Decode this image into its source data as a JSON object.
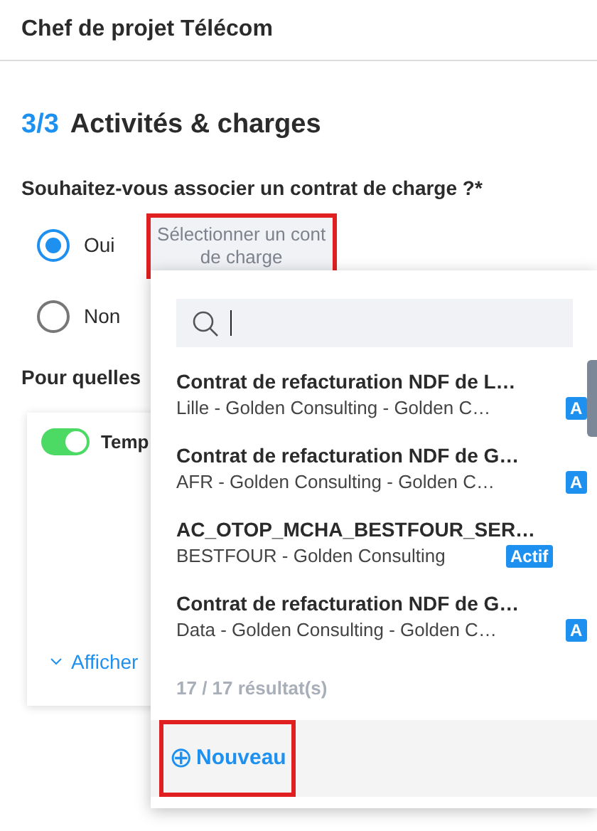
{
  "header": {
    "title": "Chef de projet Télécom"
  },
  "section": {
    "step": "3/3",
    "title": "Activités & charges"
  },
  "question": {
    "label": "Souhaitez-vous associer un contrat de charge ?*",
    "options": [
      {
        "label": "Oui",
        "selected": true
      },
      {
        "label": "Non",
        "selected": false
      }
    ],
    "select_button": {
      "label": "Sélectionner un cont de charge",
      "highlighted": true
    }
  },
  "sub_question": {
    "label": "Pour quelles"
  },
  "card": {
    "toggle": {
      "on": true,
      "label": "Temp"
    },
    "show_more": "Afficher"
  },
  "dropdown": {
    "items": [
      {
        "title": "Contrat de refacturation NDF de L…",
        "subtitle": "Lille - Golden Consulting - Golden C…",
        "badge": "A"
      },
      {
        "title": "Contrat de refacturation NDF de G…",
        "subtitle": "AFR - Golden Consulting - Golden C…",
        "badge": "A"
      },
      {
        "title": "AC_OTOP_MCHA_BESTFOUR_SER…",
        "subtitle": "BESTFOUR - Golden Consulting",
        "badge": "Actif"
      },
      {
        "title": "Contrat de refacturation NDF de G…",
        "subtitle": "Data - Golden Consulting - Golden C…",
        "badge": "A"
      }
    ],
    "results": "17 / 17 résultat(s)",
    "new_button": {
      "icon": "⊕",
      "label": "Nouveau",
      "highlighted": true
    }
  }
}
